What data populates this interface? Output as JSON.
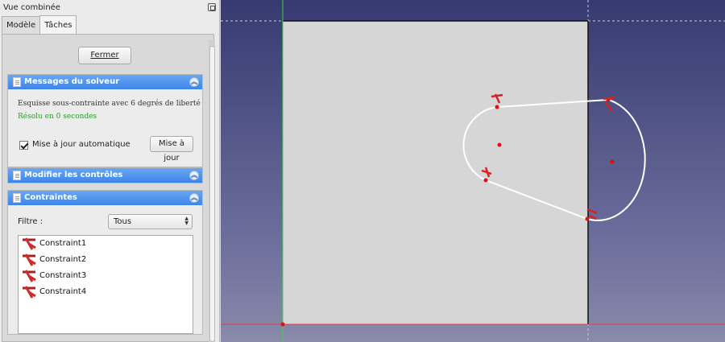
{
  "panel": {
    "title": "Vue combinée",
    "tabs": [
      {
        "label": "Modèle"
      },
      {
        "label": "Tâches"
      }
    ],
    "close_button": "Fermer"
  },
  "solver": {
    "header": "Messages du solveur",
    "message": "Esquisse sous-contrainte avec 6 degrés de liberté",
    "time": "Résolu en 0 secondes",
    "auto_update_label": "Mise à jour automatique",
    "auto_update_checked": true,
    "update_button": "Mise à jour"
  },
  "controls": {
    "header": "Modifier les contrôles"
  },
  "constraints": {
    "header": "Contraintes",
    "filter_label": "Filtre :",
    "filter_value": "Tous",
    "items": [
      {
        "label": "Constraint1",
        "icon": "tangent-constraint-icon"
      },
      {
        "label": "Constraint2",
        "icon": "tangent-constraint-icon"
      },
      {
        "label": "Constraint3",
        "icon": "tangent-constraint-icon"
      },
      {
        "label": "Constraint4",
        "icon": "tangent-constraint-icon"
      }
    ]
  },
  "viewport": {
    "background_top": "#363a70",
    "background_bottom": "#8a8aaa",
    "x_axis_color": "#e04040",
    "y_axis_color": "#40d040",
    "sketch_color": "#ffffff",
    "point_color": "#e01010",
    "face_color": "#d6d6d6"
  }
}
